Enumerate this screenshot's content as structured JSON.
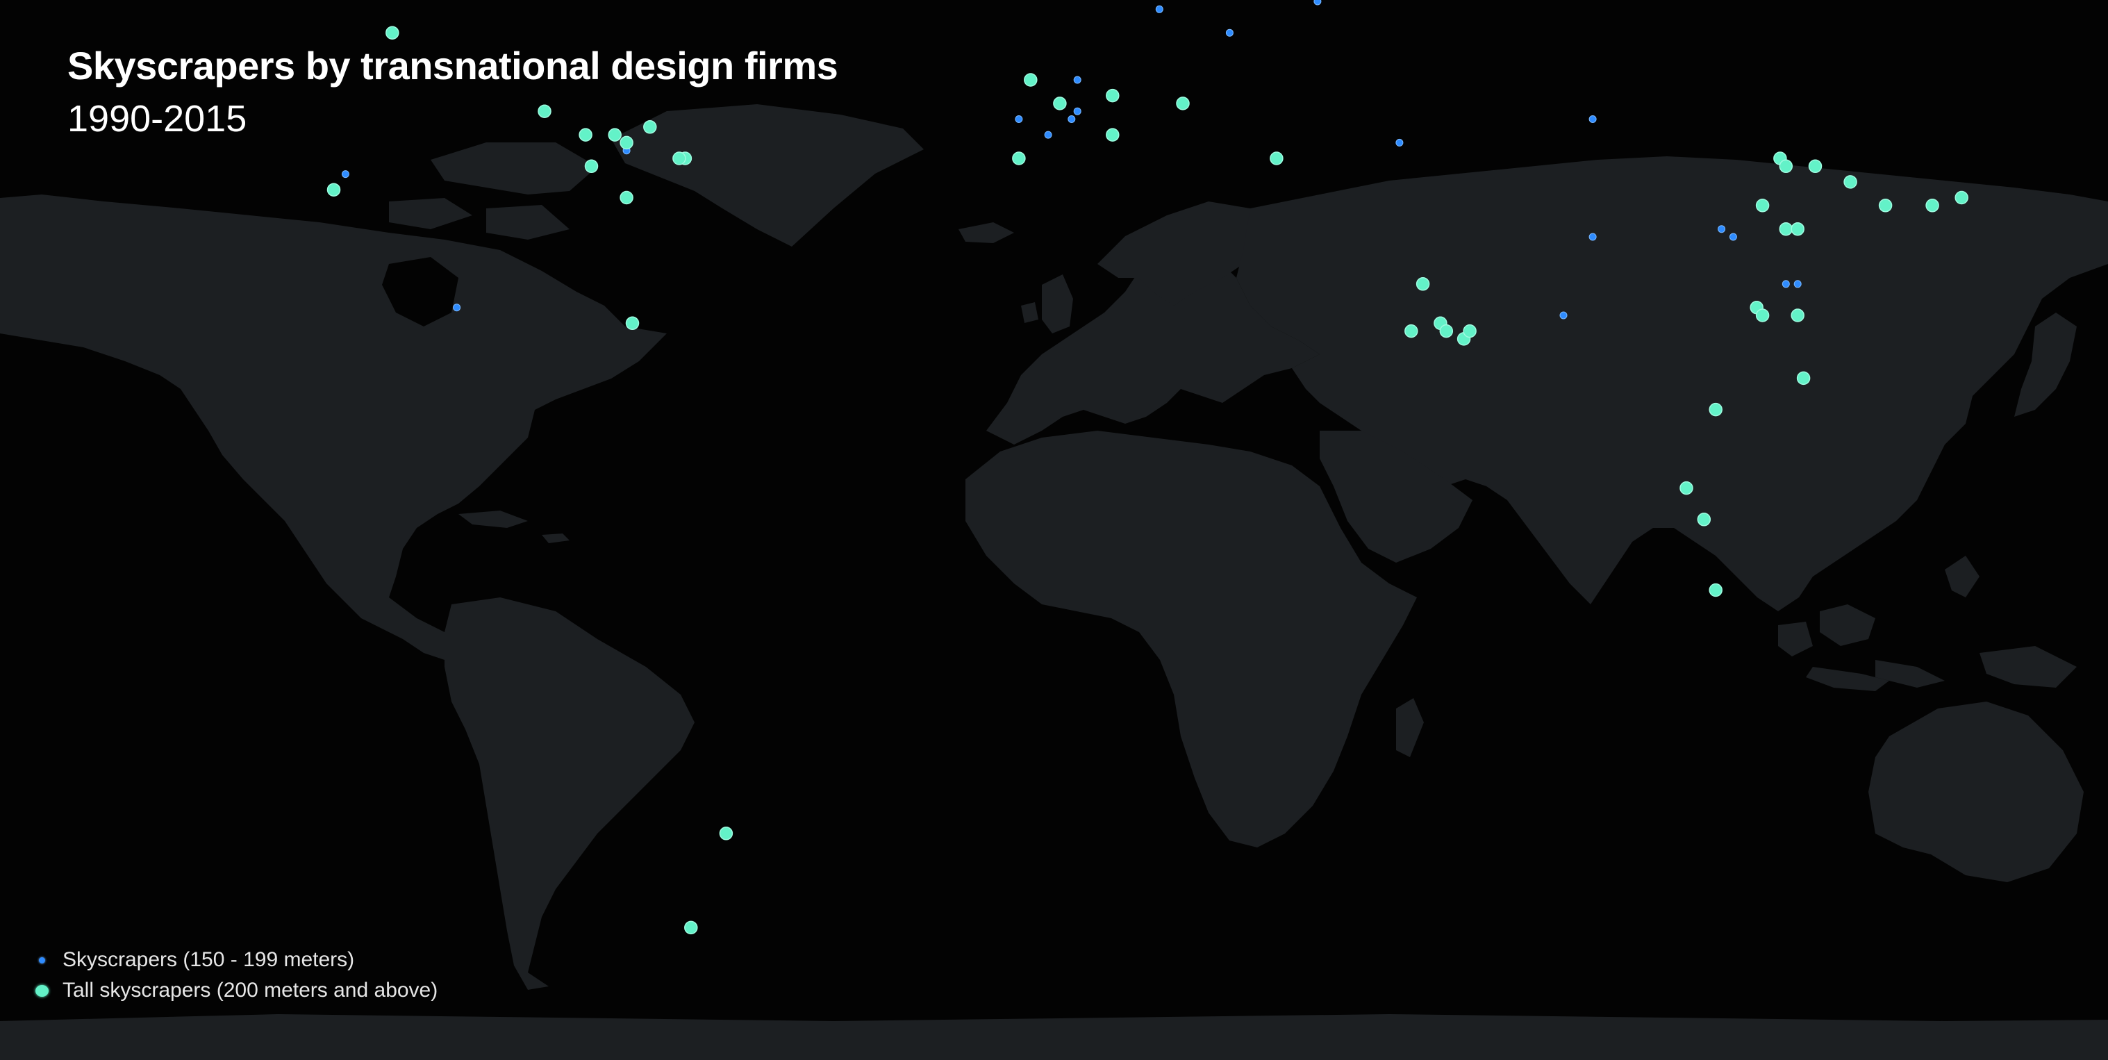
{
  "header": {
    "title": "Skyscrapers by transnational design firms",
    "subtitle": "1990-2015"
  },
  "legend": {
    "items": [
      {
        "label": "Skyscrapers (150 - 199 meters)",
        "kind": "small"
      },
      {
        "label": "Tall skyscrapers (200 meters and above)",
        "kind": "large"
      }
    ]
  },
  "colors": {
    "background": "#030303",
    "land": "#1c1f22",
    "small_marker": "#2f8cff",
    "large_marker": "#63f2c8",
    "text": "#ffffff"
  },
  "markers": {
    "small": [
      {
        "lon": -121,
        "lat": 38
      },
      {
        "lon": -102,
        "lat": 21
      },
      {
        "lon": -73,
        "lat": 41
      },
      {
        "lon": 18,
        "lat": 59
      },
      {
        "lon": 30,
        "lat": 56
      },
      {
        "lon": 45,
        "lat": 60
      },
      {
        "lon": 4,
        "lat": 50
      },
      {
        "lon": 4,
        "lat": 46
      },
      {
        "lon": 3,
        "lat": 45
      },
      {
        "lon": -6,
        "lat": 45
      },
      {
        "lon": -1,
        "lat": 43
      },
      {
        "lon": 59,
        "lat": 42
      },
      {
        "lon": 92,
        "lat": 45
      },
      {
        "lon": 92,
        "lat": 30
      },
      {
        "lon": 87,
        "lat": 20
      },
      {
        "lon": 114,
        "lat": 31
      },
      {
        "lon": 116,
        "lat": 30
      },
      {
        "lon": 125,
        "lat": 24
      },
      {
        "lon": 127,
        "lat": 24
      }
    ],
    "large": [
      {
        "lon": -113,
        "lat": 56
      },
      {
        "lon": -123,
        "lat": 36
      },
      {
        "lon": -87,
        "lat": 46
      },
      {
        "lon": -80,
        "lat": 43
      },
      {
        "lon": -75,
        "lat": 43
      },
      {
        "lon": -73,
        "lat": 42
      },
      {
        "lon": -69,
        "lat": 44
      },
      {
        "lon": -79,
        "lat": 39
      },
      {
        "lon": -73,
        "lat": 35
      },
      {
        "lon": -63,
        "lat": 40
      },
      {
        "lon": -64,
        "lat": 40
      },
      {
        "lon": -72,
        "lat": 19
      },
      {
        "lon": -4,
        "lat": 50
      },
      {
        "lon": 1,
        "lat": 47
      },
      {
        "lon": 10,
        "lat": 48
      },
      {
        "lon": 10,
        "lat": 43
      },
      {
        "lon": 22,
        "lat": 47
      },
      {
        "lon": -6,
        "lat": 40
      },
      {
        "lon": 38,
        "lat": 40
      },
      {
        "lon": 63,
        "lat": 24
      },
      {
        "lon": 61,
        "lat": 18
      },
      {
        "lon": 66,
        "lat": 19
      },
      {
        "lon": 67,
        "lat": 18
      },
      {
        "lon": 70,
        "lat": 17
      },
      {
        "lon": 71,
        "lat": 18
      },
      {
        "lon": 124,
        "lat": 40
      },
      {
        "lon": 125,
        "lat": 39
      },
      {
        "lon": 130,
        "lat": 39
      },
      {
        "lon": 121,
        "lat": 34
      },
      {
        "lon": 125,
        "lat": 31
      },
      {
        "lon": 127,
        "lat": 31
      },
      {
        "lon": 136,
        "lat": 37
      },
      {
        "lon": 142,
        "lat": 34
      },
      {
        "lon": 150,
        "lat": 34
      },
      {
        "lon": 155,
        "lat": 35
      },
      {
        "lon": 120,
        "lat": 21
      },
      {
        "lon": 121,
        "lat": 20
      },
      {
        "lon": 127,
        "lat": 20
      },
      {
        "lon": 128,
        "lat": 12
      },
      {
        "lon": 113,
        "lat": 8
      },
      {
        "lon": 108,
        "lat": -2
      },
      {
        "lon": 111,
        "lat": -6
      },
      {
        "lon": 113,
        "lat": -15
      },
      {
        "lon": -56,
        "lat": -46
      },
      {
        "lon": -62,
        "lat": -58
      }
    ]
  }
}
